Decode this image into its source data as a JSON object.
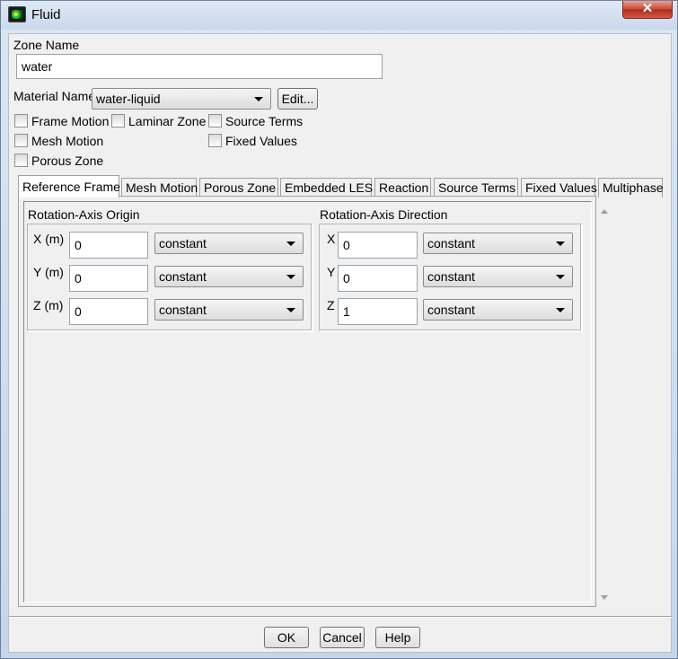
{
  "window": {
    "title": "Fluid",
    "close_glyph": "✕"
  },
  "zone": {
    "label": "Zone Name",
    "value": "water"
  },
  "material": {
    "label": "Material Name",
    "selected": "water-liquid",
    "edit_label": "Edit..."
  },
  "checkboxes": {
    "frame_motion": "Frame Motion",
    "laminar_zone": "Laminar Zone",
    "source_terms": "Source Terms",
    "mesh_motion": "Mesh Motion",
    "fixed_values": "Fixed Values",
    "porous_zone": "Porous Zone"
  },
  "tabs": [
    "Reference Frame",
    "Mesh Motion",
    "Porous Zone",
    "Embedded LES",
    "Reaction",
    "Source Terms",
    "Fixed Values",
    "Multiphase"
  ],
  "origin": {
    "title": "Rotation-Axis Origin",
    "x_label": "X (m)",
    "x_value": "0",
    "x_method": "constant",
    "y_label": "Y (m)",
    "y_value": "0",
    "y_method": "constant",
    "z_label": "Z (m)",
    "z_value": "0",
    "z_method": "constant"
  },
  "direction": {
    "title": "Rotation-Axis Direction",
    "x_label": "X",
    "x_value": "0",
    "x_method": "constant",
    "y_label": "Y",
    "y_value": "0",
    "y_method": "constant",
    "z_label": "Z",
    "z_value": "1",
    "z_method": "constant"
  },
  "buttons": {
    "ok": "OK",
    "cancel": "Cancel",
    "help": "Help"
  }
}
